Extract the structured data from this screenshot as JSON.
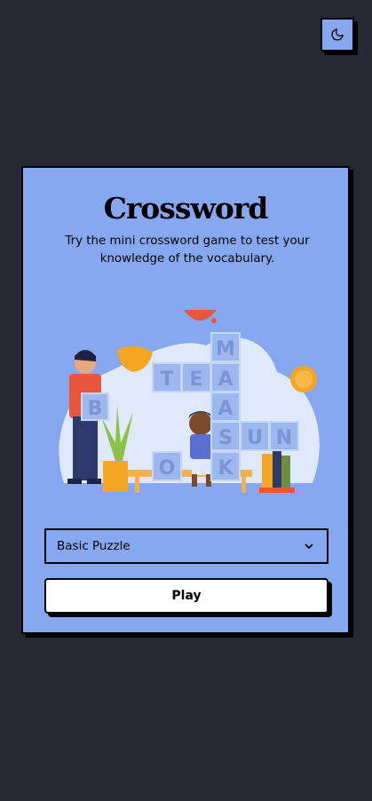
{
  "header": {
    "theme_toggle_icon": "moon-icon"
  },
  "card": {
    "title": "Crossword",
    "description": "Try the mini crossword game to test your knowledge of the vocabulary.",
    "illustration": {
      "tiles": [
        "M",
        "T",
        "E",
        "A",
        "A",
        "S",
        "U",
        "N",
        "O",
        "K",
        "B"
      ]
    },
    "puzzle_select": {
      "value": "Basic Puzzle",
      "icon": "chevron-down-icon"
    },
    "play_label": "Play"
  },
  "colors": {
    "background": "#262833",
    "card": "#86a8f0",
    "border": "#000000",
    "button": "#ffffff"
  }
}
